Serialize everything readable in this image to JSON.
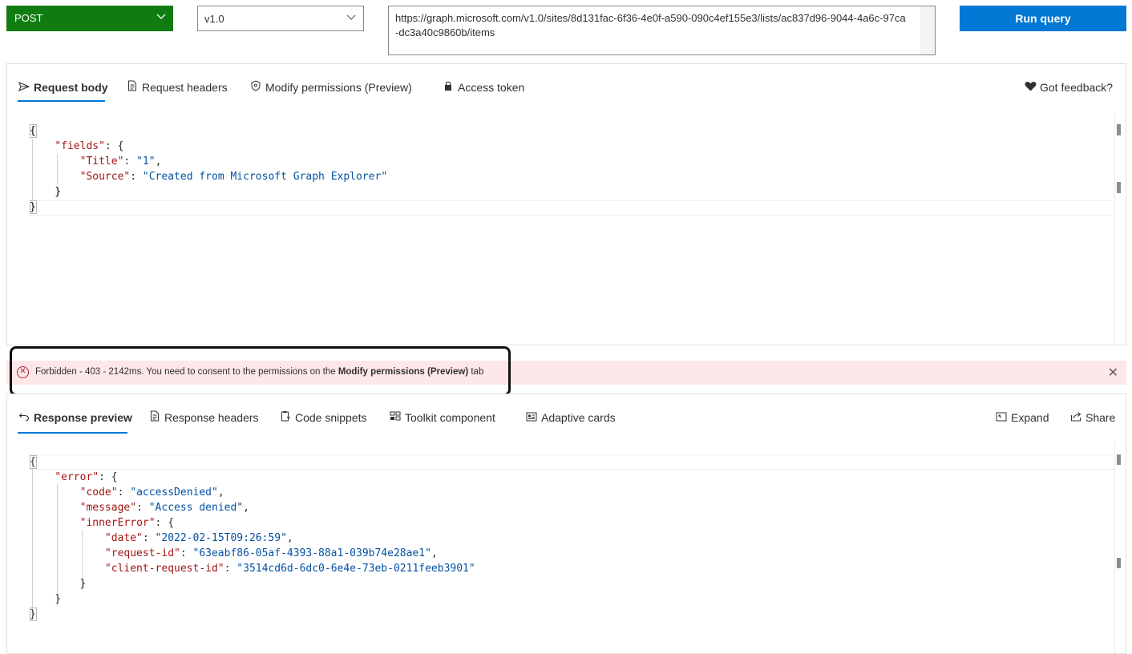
{
  "query": {
    "method": "POST",
    "version": "v1.0",
    "url": "https://graph.microsoft.com/v1.0/sites/8d131fac-6f36-4e0f-a590-090c4ef155e3/lists/ac837d96-9044-4a6c-97ca-dc3a40c9860b/items",
    "run_label": "Run query"
  },
  "request": {
    "tabs": [
      {
        "label": "Request body",
        "icon": "send-icon",
        "active": true
      },
      {
        "label": "Request headers",
        "icon": "document-icon",
        "active": false
      },
      {
        "label": "Modify permissions (Preview)",
        "icon": "shield-icon",
        "active": false
      },
      {
        "label": "Access token",
        "icon": "lock-icon",
        "active": false
      }
    ],
    "feedback_label": "Got feedback?",
    "feedback_icon": "heart-icon",
    "body_lines": [
      "{",
      "    \"fields\": {",
      "        \"Title\": \"1\",",
      "        \"Source\": \"Created from Microsoft Graph Explorer\"",
      "    }",
      "}"
    ]
  },
  "error": {
    "prefix": "Forbidden - 403 - 2142ms. You need to consent to the permissions on the ",
    "emphasis": "Modify permissions (Preview)",
    "suffix": " tab",
    "icon": "error-circle-icon",
    "close_icon": "close-icon",
    "color": "#a4262c"
  },
  "response": {
    "tabs": [
      {
        "label": "Response preview",
        "icon": "undo-icon",
        "active": true
      },
      {
        "label": "Response headers",
        "icon": "document-icon",
        "active": false
      },
      {
        "label": "Code snippets",
        "icon": "clipboard-code-icon",
        "active": false
      },
      {
        "label": "Toolkit component",
        "icon": "toolkit-icon",
        "active": false
      },
      {
        "label": "Adaptive cards",
        "icon": "card-icon",
        "active": false
      }
    ],
    "actions": [
      {
        "label": "Expand",
        "icon": "expand-icon"
      },
      {
        "label": "Share",
        "icon": "share-icon"
      }
    ],
    "body_lines": [
      "{",
      "    \"error\": {",
      "        \"code\": \"accessDenied\",",
      "        \"message\": \"Access denied\",",
      "        \"innerError\": {",
      "            \"date\": \"2022-02-15T09:26:59\",",
      "            \"request-id\": \"63eabf86-05af-4393-88a1-039b74e28ae1\",",
      "            \"client-request-id\": \"3514cd6d-6dc0-6e4e-73eb-0211feeb3901\"",
      "        }",
      "    }",
      "}"
    ]
  },
  "colors": {
    "method_bg": "#107c10",
    "run_bg": "#0078d4",
    "accent": "#0078d4",
    "error_bg": "#fde7e9",
    "json_key": "#a31515",
    "json_string": "#0451a5"
  }
}
